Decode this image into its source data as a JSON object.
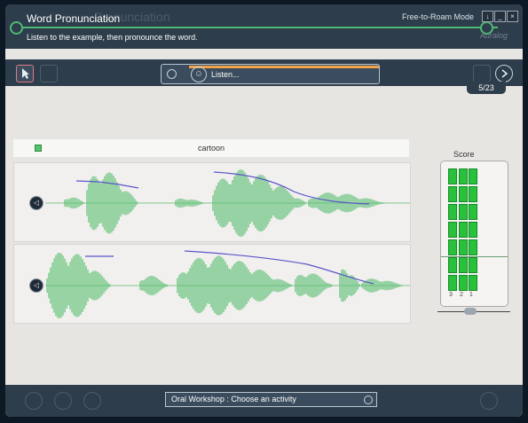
{
  "header": {
    "title": "Word Pronunciation",
    "ghost_title": "Pronunciation",
    "instruction": "Listen to the example, then pronounce the word.",
    "mode": "Free-to-Roam Mode",
    "brand": "Auralog",
    "buttons": {
      "help": "↓",
      "minimize": "_",
      "close": "×"
    }
  },
  "toolbar": {
    "status_label": "Listen...",
    "counter": "5/23"
  },
  "word": "cartoon",
  "score": {
    "label": "Score",
    "numbers": [
      "3",
      "2",
      "1"
    ]
  },
  "footer": {
    "activity_label": "Oral Workshop : Choose an activity"
  },
  "colors": {
    "accent": "#4fb873",
    "progress": "#f1a347",
    "score_green": "#27c23a"
  }
}
